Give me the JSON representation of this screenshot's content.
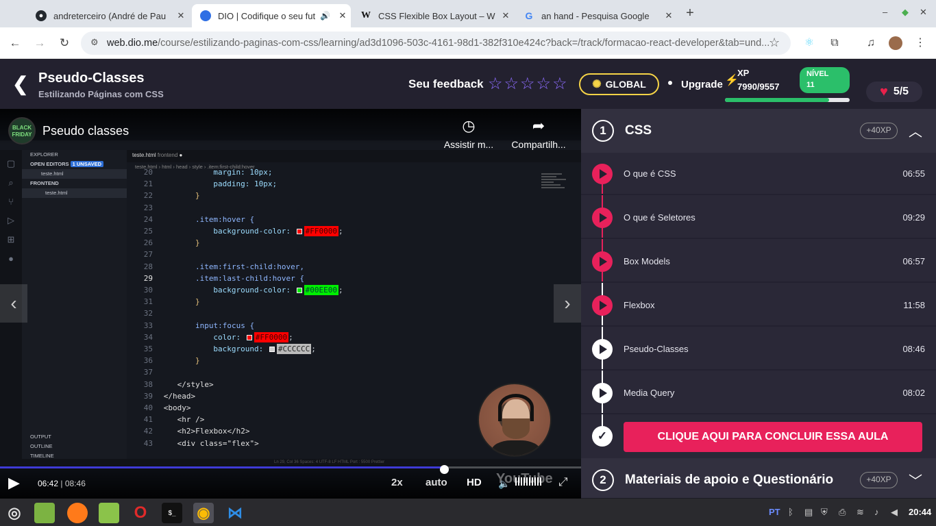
{
  "browser": {
    "tabs": [
      {
        "title": "andreterceiro (André de Pau",
        "favicon": "github-icon",
        "active": false
      },
      {
        "title": "DIO | Codifique o seu fut",
        "favicon": "dio-icon",
        "active": true
      },
      {
        "title": "CSS Flexible Box Layout – W",
        "favicon": "wikipedia-icon",
        "active": false
      },
      {
        "title": "an hand - Pesquisa Google",
        "favicon": "google-icon",
        "active": false
      }
    ],
    "new_tab": "+",
    "url_host": "web.dio.me",
    "url_path": "/course/estilizando-paginas-com-css/learning/ad3d1096-503c-4161-98d1-382f310e424c?back=/track/formacao-react-developer&tab=und..."
  },
  "header": {
    "back": "❮",
    "title": "Pseudo-Classes",
    "subtitle": "Estilizando Páginas com CSS",
    "feedback_label": "Seu feedback",
    "stars": "☆☆☆☆☆",
    "global_label": "GLOBAL",
    "upgrade_label": "Upgrade",
    "xp_label": "XP",
    "xp_value": "7990/9557",
    "xp_progress": 0.836,
    "level_label": "NÍVEL",
    "level_value": "11",
    "lives": "5/5",
    "accent": "#e8215b"
  },
  "video": {
    "title": "Pseudo classes",
    "channel": "BLACK\nFRIDAY",
    "watch_later": "Assistir m...",
    "share": "Compartilh...",
    "current_time": "06:42",
    "separator": "|",
    "duration": "08:46",
    "progress": 0.764,
    "speed": "2x",
    "quality_mode": "auto",
    "hd": "HD",
    "youtube": "YouTube",
    "editor": {
      "explorer": "EXPLORER",
      "open_editors": "OPEN EDITORS",
      "unsaved": "1 UNSAVED",
      "file": "teste.html",
      "folder": "FRONTEND",
      "output": "OUTPUT",
      "outline": "OUTLINE",
      "timeline": "TIMELINE",
      "tab_label": "teste.html",
      "tab_folder": "frontend",
      "breadcrumb": "teste.html  ›  html  ›  head  ›  style  ›  .item:first-child:hover",
      "status": "Ln 29, Col 36    Spaces: 4    UTF-8    LF    HTML    Port : 5500    Prettier"
    },
    "code_lines": [
      {
        "n": "20",
        "t": "margin: 10px;"
      },
      {
        "n": "21",
        "t": "padding: 10px;"
      },
      {
        "n": "22",
        "t": "}"
      },
      {
        "n": "23",
        "t": ""
      },
      {
        "n": "24",
        "t": ".item:hover {"
      },
      {
        "n": "25",
        "t": "background-color: ",
        "c": "#FF0000",
        "end": ";"
      },
      {
        "n": "26",
        "t": "}"
      },
      {
        "n": "27",
        "t": ""
      },
      {
        "n": "28",
        "t": ".item:first-child:hover,"
      },
      {
        "n": "29",
        "t": ".item:last-child:hover {"
      },
      {
        "n": "30",
        "t": "background-color: ",
        "c": "#00EE00",
        "end": ";"
      },
      {
        "n": "31",
        "t": "}"
      },
      {
        "n": "32",
        "t": ""
      },
      {
        "n": "33",
        "t": "input:focus {"
      },
      {
        "n": "34",
        "t": "color: ",
        "c": "#FF0000",
        "end": ";"
      },
      {
        "n": "35",
        "t": "background: ",
        "c": "#CCCCCC",
        "end": ";"
      },
      {
        "n": "36",
        "t": "}"
      },
      {
        "n": "37",
        "t": ""
      },
      {
        "n": "38",
        "t": "</style>"
      },
      {
        "n": "39",
        "t": "</head>"
      },
      {
        "n": "40",
        "t": "<body>"
      },
      {
        "n": "41",
        "t": "<hr />"
      },
      {
        "n": "42",
        "t": "<h2>Flexbox</h2>"
      },
      {
        "n": "43",
        "t": "<div class=\"flex\">"
      }
    ]
  },
  "panel": {
    "section1": {
      "number": "1",
      "title": "CSS",
      "xp": "+40XP"
    },
    "lessons": [
      {
        "name": "O que é CSS",
        "duration": "06:55",
        "done": true
      },
      {
        "name": "O que é Seletores",
        "duration": "09:29",
        "done": true
      },
      {
        "name": "Box Models",
        "duration": "06:57",
        "done": true
      },
      {
        "name": "Flexbox",
        "duration": "11:58",
        "done": true
      },
      {
        "name": "Pseudo-Classes",
        "duration": "08:46",
        "done": false
      },
      {
        "name": "Media Query",
        "duration": "08:02",
        "done": false
      }
    ],
    "conclude_label": "CLIQUE AQUI PARA CONCLUIR ESSA AULA",
    "section2": {
      "number": "2",
      "title": "Materiais de apoio e Questionário",
      "xp": "+40XP"
    }
  },
  "taskbar": {
    "lang": "PT",
    "clock": "20:44"
  }
}
